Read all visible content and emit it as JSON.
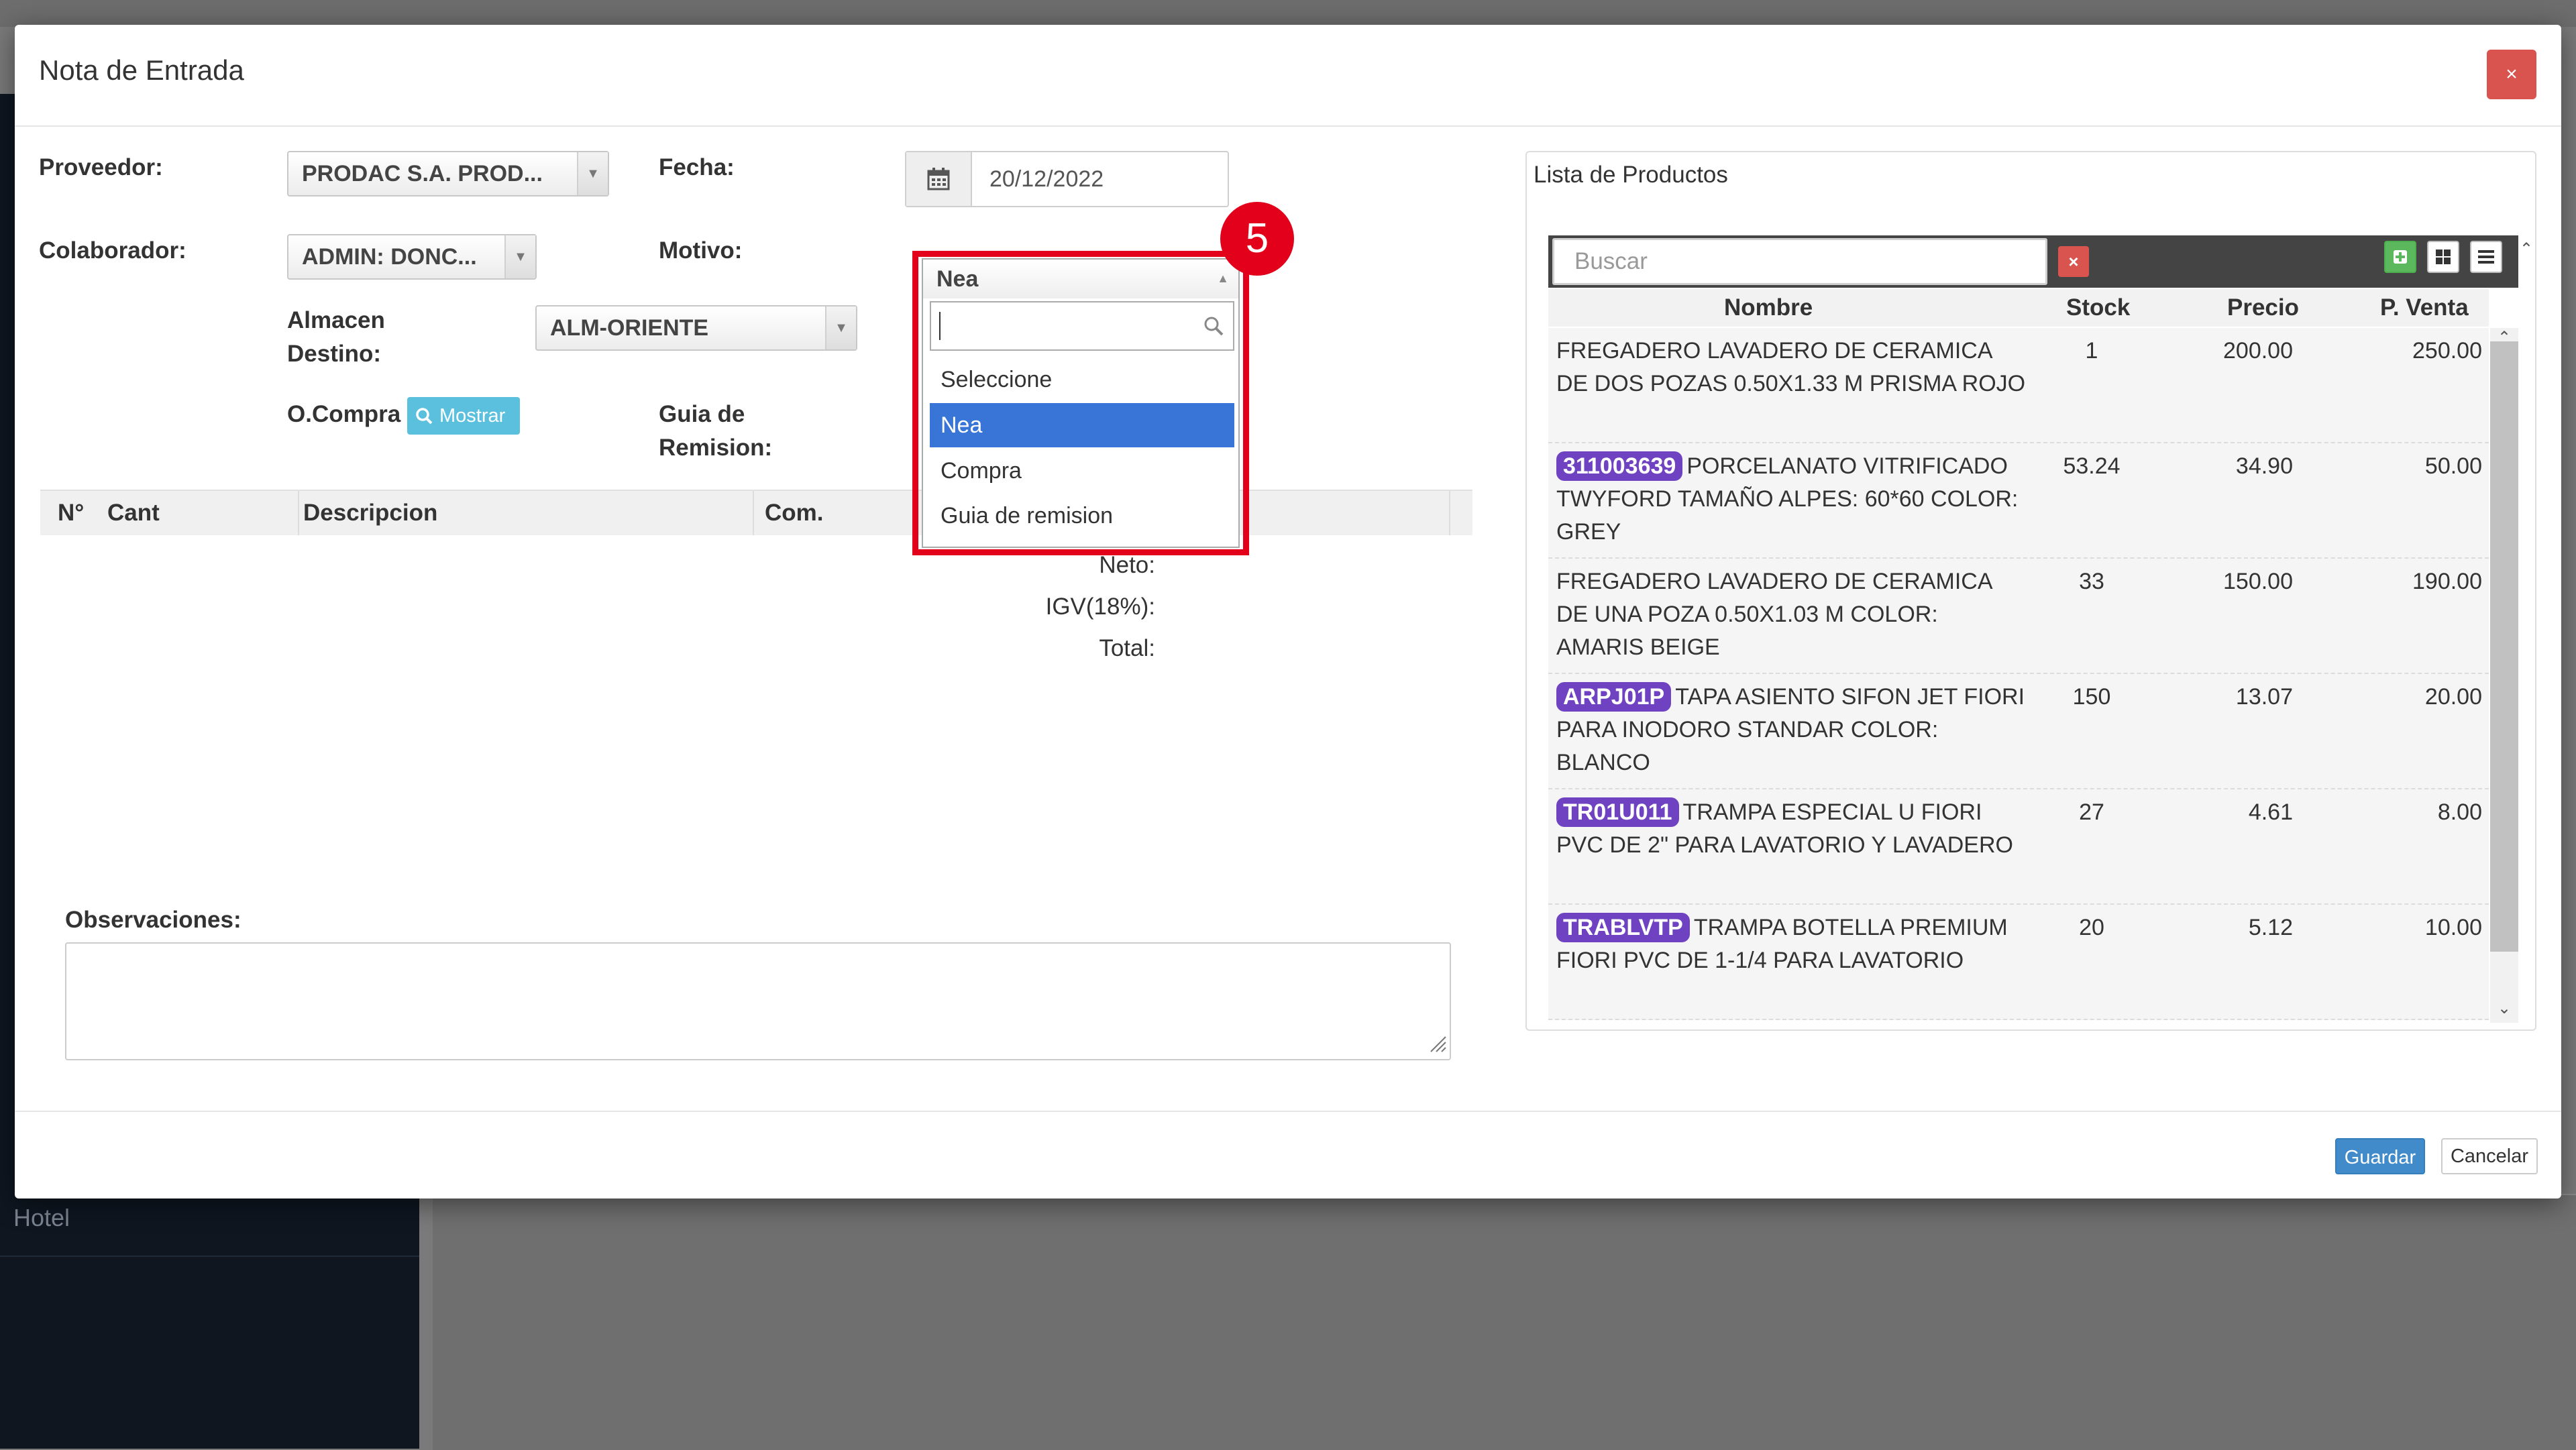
{
  "background": {
    "sidebar_item": "Hotel"
  },
  "modal": {
    "title": "Nota de Entrada",
    "close_label": "×",
    "form": {
      "proveedor_label": "Proveedor:",
      "proveedor_value": "PRODAC S.A. PROD...",
      "fecha_label": "Fecha:",
      "fecha_value": "20/12/2022",
      "colaborador_label": "Colaborador:",
      "colaborador_value": "ADMIN: DONC...",
      "motivo_label": "Motivo:",
      "motivo_value": "Nea",
      "almacen_label_1": "Almacen",
      "almacen_label_2": "Destino:",
      "almacen_value": "ALM-ORIENTE",
      "ocompra_label": "O.Compra",
      "mostrar_label": "Mostrar",
      "guia_label_1": "Guia de",
      "guia_label_2": "Remision:"
    },
    "motivo_dropdown": {
      "options": [
        "Seleccione",
        "Nea",
        "Compra",
        "Guia de remision"
      ],
      "selected": "Nea"
    },
    "step_number": "5",
    "items_table": {
      "columns": [
        "N°",
        "Cant",
        "Descripcion",
        "Com."
      ]
    },
    "totals": {
      "neto": "Neto:",
      "igv": "IGV(18%):",
      "total": "Total:"
    },
    "observaciones_label": "Observaciones:",
    "footer": {
      "save": "Guardar",
      "cancel": "Cancelar"
    },
    "colors": {
      "primary": "#428bca",
      "danger": "#d9534f",
      "info": "#5bc0de",
      "badge": "#6f42c1",
      "highlight": "#e3001b"
    }
  },
  "products": {
    "title": "Lista de Productos",
    "search_placeholder": "Buscar",
    "clear_label": "×",
    "columns": [
      "Nombre",
      "Stock",
      "Precio",
      "P. Venta"
    ],
    "rows": [
      {
        "code": "",
        "name": "FREGADERO LAVADERO DE CERAMICA DE DOS POZAS 0.50X1.33 M PRISMA ROJO",
        "stock": "1",
        "precio": "200.00",
        "venta": "250.00"
      },
      {
        "code": "311003639",
        "name": "PORCELANATO VITRIFICADO TWYFORD TAMAÑO ALPES: 60*60 COLOR: GREY",
        "stock": "53.24",
        "precio": "34.90",
        "venta": "50.00"
      },
      {
        "code": "",
        "name": "FREGADERO LAVADERO DE CERAMICA DE UNA POZA 0.50X1.03 M COLOR: AMARIS BEIGE",
        "stock": "33",
        "precio": "150.00",
        "venta": "190.00"
      },
      {
        "code": "ARPJ01P",
        "name": "TAPA ASIENTO SIFON JET FIORI PARA INODORO STANDAR COLOR: BLANCO",
        "stock": "150",
        "precio": "13.07",
        "venta": "20.00"
      },
      {
        "code": "TR01U011",
        "name": "TRAMPA ESPECIAL U FIORI PVC DE 2\" PARA LAVATORIO Y LAVADERO",
        "stock": "27",
        "precio": "4.61",
        "venta": "8.00"
      },
      {
        "code": "TRABLVTP",
        "name": "TRAMPA BOTELLA PREMIUM FIORI PVC DE 1-1/4 PARA LAVATORIO",
        "stock": "20",
        "precio": "5.12",
        "venta": "10.00"
      }
    ]
  }
}
